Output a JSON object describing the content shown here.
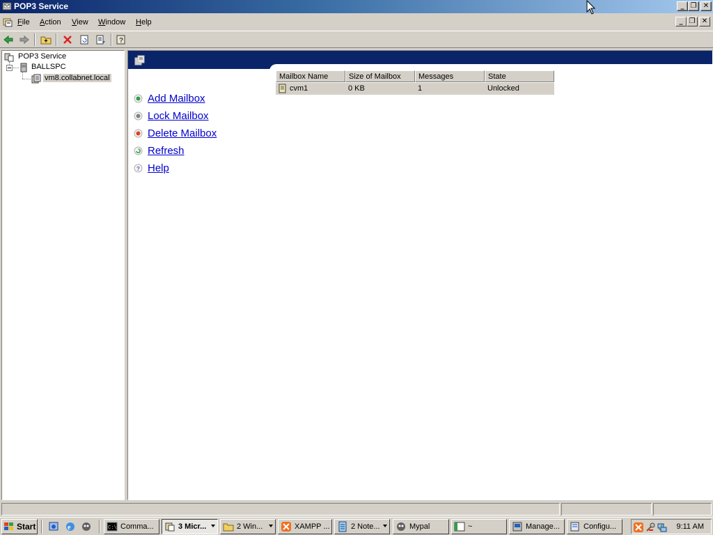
{
  "window": {
    "title": "POP3 Service",
    "controls": {
      "minimize": "_",
      "restore": "❐",
      "close": "✕"
    }
  },
  "menubar": {
    "items": [
      {
        "label": "File",
        "mnemonic": "F",
        "rest": "ile"
      },
      {
        "label": "Action",
        "mnemonic": "A",
        "rest": "ction"
      },
      {
        "label": "View",
        "mnemonic": "V",
        "rest": "iew"
      },
      {
        "label": "Window",
        "mnemonic": "W",
        "rest": "indow"
      },
      {
        "label": "Help",
        "mnemonic": "H",
        "rest": "elp"
      }
    ]
  },
  "toolbar": {
    "icons": [
      "back-arrow-icon",
      "forward-arrow-icon",
      "up-folder-icon",
      "delete-icon",
      "refresh-icon",
      "export-list-icon",
      "help-icon"
    ]
  },
  "tree": {
    "root": "POP3 Service",
    "server": "BALLSPC",
    "domain": "vm8.collabnet.local"
  },
  "tasks": [
    {
      "label": "Add Mailbox",
      "icon": "add-icon",
      "color": "#2ea043"
    },
    {
      "label": "Lock Mailbox",
      "icon": "lock-icon",
      "color": "#808080"
    },
    {
      "label": "Delete Mailbox",
      "icon": "delete-icon",
      "color": "#e04020"
    },
    {
      "label": "Refresh",
      "icon": "refresh-icon",
      "color": "#2ea043"
    },
    {
      "label": "Help",
      "icon": "help-icon",
      "color": "#6060c0"
    }
  ],
  "mailbox_list": {
    "columns": [
      "Mailbox Name",
      "Size of Mailbox",
      "Messages",
      "State"
    ],
    "rows": [
      {
        "name": "cvm1",
        "size": "0 KB",
        "messages": "1",
        "state": "Unlocked"
      }
    ]
  },
  "taskbar": {
    "start_label": "Start",
    "buttons": [
      {
        "label": "Comma...",
        "icon": "command-prompt-icon"
      },
      {
        "label": "3 Micr...",
        "icon": "mmc-icon",
        "pressed": true,
        "group": true
      },
      {
        "label": "2 Win...",
        "icon": "folder-icon",
        "group": true
      },
      {
        "label": "XAMPP ...",
        "icon": "xampp-icon"
      },
      {
        "label": "2 Note...",
        "icon": "notepad-icon",
        "group": true
      },
      {
        "label": "Mypal",
        "icon": "mypal-icon"
      },
      {
        "label": "~",
        "icon": "terminal-icon"
      },
      {
        "label": "Manage...",
        "icon": "manage-icon"
      },
      {
        "label": "Configu...",
        "icon": "configure-icon"
      }
    ],
    "clock": "9:11 AM"
  },
  "colors": {
    "title_start": "#0a246a",
    "title_end": "#a6caf0",
    "banner": "#0a246a",
    "link": "#0000cc",
    "face": "#d4d0c8"
  }
}
